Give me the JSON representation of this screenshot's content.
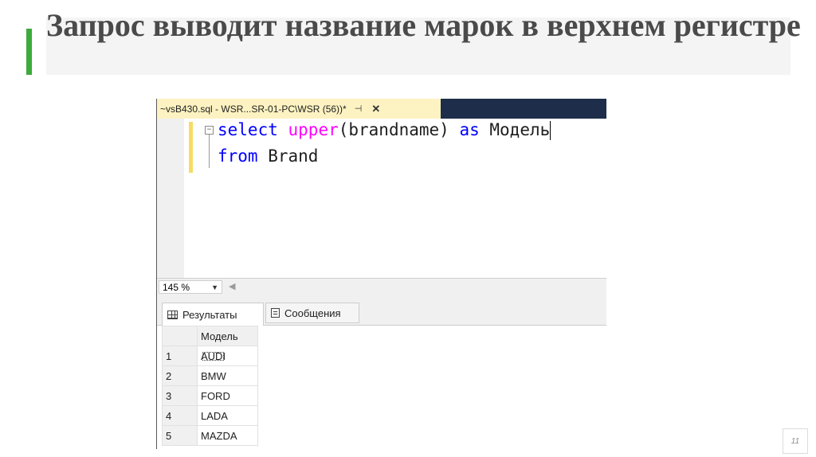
{
  "slide": {
    "title": "Запрос выводит название марок в верхнем регистре",
    "page_number": "11"
  },
  "ssms": {
    "tab_title": "~vsB430.sql - WSR...SR-01-PC\\WSR (56))*",
    "pin_glyph": "⊣",
    "close_glyph": "✕",
    "code": {
      "line1": {
        "kw1": "select",
        "fn": "upper",
        "rest": "(brandname) ",
        "kw2": "as",
        "alias": " Модель"
      },
      "line2": {
        "kw": "from",
        "table": " Brand"
      }
    },
    "zoom": "145 %",
    "results_tabs": {
      "results": "Результаты",
      "messages": "Сообщения"
    },
    "grid": {
      "column": "Модель",
      "rows": [
        {
          "num": "1",
          "value": "AUDI"
        },
        {
          "num": "2",
          "value": "BMW"
        },
        {
          "num": "3",
          "value": "FORD"
        },
        {
          "num": "4",
          "value": "LADA"
        },
        {
          "num": "5",
          "value": "MAZDA"
        }
      ]
    }
  },
  "colors": {
    "accent": "#3daa3d",
    "tab_bar": "#1e2d49",
    "active_doc_tab": "#fdf3c2",
    "keyword": "#0000ff",
    "function": "#ff00ff"
  }
}
